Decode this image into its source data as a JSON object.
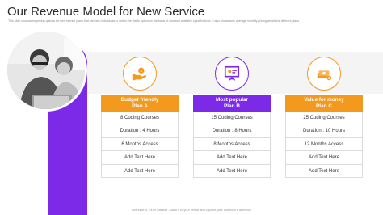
{
  "slide": {
    "title": "Our Revenue Model for New Service",
    "subtitle": "This slide showcases pricing options for new service plans that can help individuals to select the viable option on the basis of cost and available specifications. It also showcases average monthly pricing details for different plans",
    "footer": "This slide is 100% editable. Adapt it to your needs and capture your audience's attention.",
    "colors": {
      "accent_orange": "#f39a1e",
      "accent_purple": "#7d2ae8"
    }
  },
  "plans": [
    {
      "icon": "hand-money-icon",
      "header_line1": "Budget friendly",
      "header_line2": "Plan A",
      "features": [
        "8 Coding Courses",
        "Duration : 4 Hours",
        "6 Months Access",
        "Add Text Here",
        "Add Text Here"
      ]
    },
    {
      "icon": "presentation-icon",
      "header_line1": "Most popular",
      "header_line2": "Plan B",
      "features": [
        "15 Coding Courses",
        "Duration : 8 Hours",
        "8 Months Access",
        "Add Text Here",
        "Add Text Here"
      ]
    },
    {
      "icon": "money-stack-icon",
      "header_line1": "Value for money",
      "header_line2": "Plan C",
      "features": [
        "25 Coding Courses",
        "Duration : 10 Hours",
        "12 Months Access",
        "Add Text Here",
        "Add Text Here"
      ]
    }
  ]
}
